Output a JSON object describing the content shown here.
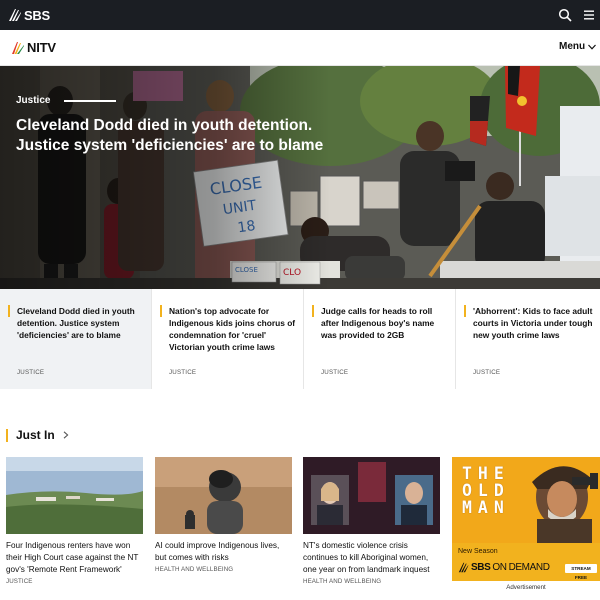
{
  "topbar": {
    "logo_text": "SBS"
  },
  "nitvbar": {
    "logo_text": "NITV",
    "menu_label": "Menu"
  },
  "hero": {
    "category": "Justice",
    "title": "Cleveland Dodd died in youth detention. Justice system 'deficiencies' are to blame",
    "placards": {
      "sign1": "CLOSE\nUNIT\n18",
      "sign2": "CLOSE",
      "sign3": "CLO"
    }
  },
  "stories": [
    {
      "title": "Cleveland Dodd died in youth detention. Justice system 'deficiencies' are to blame",
      "category": "JUSTICE"
    },
    {
      "title": "Nation's top advocate for Indigenous kids joins chorus of condemnation for 'cruel' Victorian youth crime laws",
      "category": "JUSTICE"
    },
    {
      "title": "Judge calls for heads to roll after Indigenous boy's name was provided to 2GB",
      "category": "JUSTICE"
    },
    {
      "title": "'Abhorrent': Kids to face adult courts in Victoria under tough new youth crime laws",
      "category": "JUSTICE"
    }
  ],
  "just_in": {
    "heading": "Just In",
    "items": [
      {
        "title": "Four Indigenous renters have won their High Court case against the NT gov's 'Remote Rent Framework'",
        "category": "JUSTICE"
      },
      {
        "title": "AI could improve Indigenous lives, but comes with risks",
        "category": "HEALTH AND WELLBEING"
      },
      {
        "title": "NT's domestic violence crisis continues to kill Aboriginal women, one year on from landmark inquest",
        "category": "HEALTH AND WELLBEING"
      }
    ]
  },
  "ad": {
    "title": "THE OLD MAN",
    "new_season": "New Season",
    "brand_prefix": "SBS",
    "brand_on": "ON",
    "brand_demand": "DEMAND",
    "stream_free": "STREAM FREE",
    "label": "Advertisement"
  },
  "colors": {
    "accent": "#f2b21e",
    "topbar": "#1b1e23",
    "story_active_bg": "#f0f2f4"
  },
  "icons": {
    "logo": "sbs-logo-icon",
    "search": "search-icon",
    "menu": "hamburger-icon",
    "chevron": "chevron-down-icon",
    "arrow": "chevron-right-icon"
  }
}
